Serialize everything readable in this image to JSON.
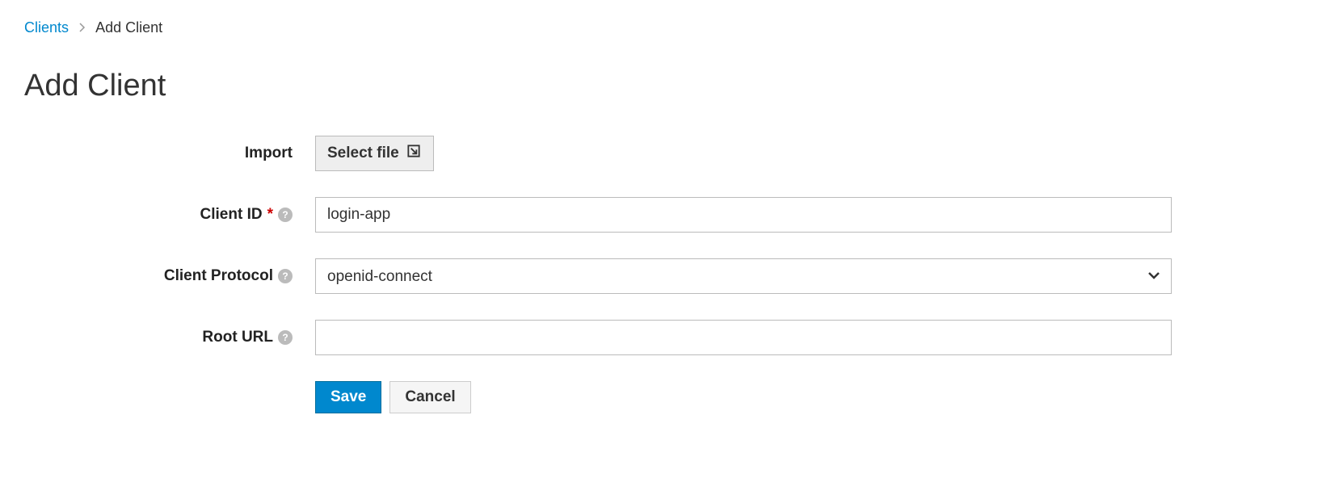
{
  "breadcrumb": {
    "parent": "Clients",
    "current": "Add Client"
  },
  "page": {
    "title": "Add Client"
  },
  "form": {
    "import_label": "Import",
    "select_file_label": "Select file",
    "client_id_label": "Client ID",
    "client_id_value": "login-app",
    "client_protocol_label": "Client Protocol",
    "client_protocol_value": "openid-connect",
    "root_url_label": "Root URL",
    "root_url_value": ""
  },
  "actions": {
    "save_label": "Save",
    "cancel_label": "Cancel"
  }
}
